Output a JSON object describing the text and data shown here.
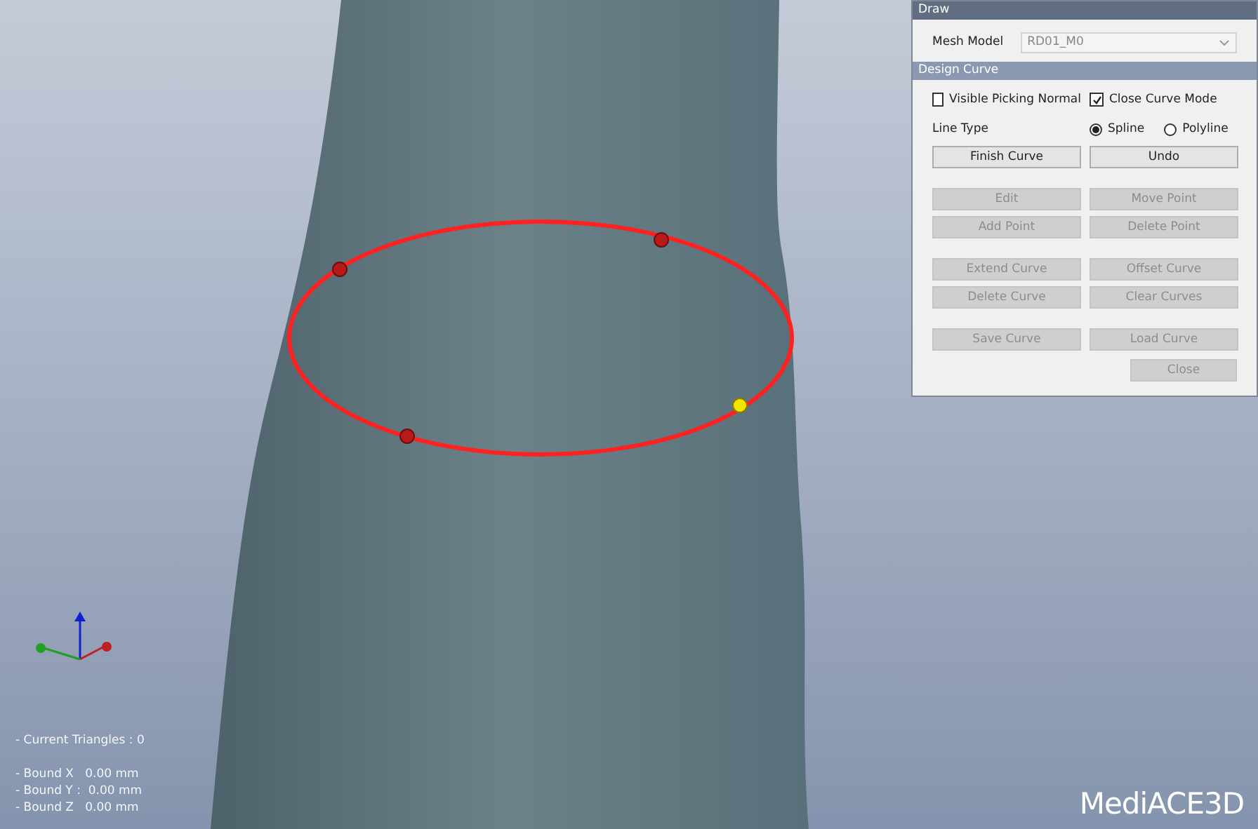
{
  "draw_panel": {
    "title": "Draw",
    "mesh_model": {
      "label": "Mesh Model",
      "value": "RD01_M0"
    }
  },
  "design_curve": {
    "title": "Design Curve",
    "checkboxes": [
      {
        "label": "Visible Picking Normal",
        "checked": false
      },
      {
        "label": "Close Curve Mode",
        "checked": true
      }
    ],
    "line_type": {
      "label": "Line Type",
      "options": [
        {
          "label": "Spline",
          "selected": true
        },
        {
          "label": "Polyline",
          "selected": false
        }
      ]
    },
    "button_groups": [
      [
        {
          "label": "Finish Curve",
          "disabled": false
        },
        {
          "label": "Undo",
          "disabled": false
        }
      ],
      [
        {
          "label": "Edit",
          "disabled": true
        },
        {
          "label": "Move Point",
          "disabled": true
        },
        {
          "label": "Add Point",
          "disabled": true
        },
        {
          "label": "Delete Point",
          "disabled": true
        }
      ],
      [
        {
          "label": "Extend Curve",
          "disabled": true
        },
        {
          "label": "Offset Curve",
          "disabled": true
        },
        {
          "label": "Delete Curve",
          "disabled": true
        },
        {
          "label": "Clear Curves",
          "disabled": true
        }
      ],
      [
        {
          "label": "Save Curve",
          "disabled": true
        },
        {
          "label": "Load Curve",
          "disabled": true
        }
      ]
    ],
    "close_button": {
      "label": "Close",
      "disabled": true
    }
  },
  "curve_points": [
    {
      "selected": false
    },
    {
      "selected": false
    },
    {
      "selected": true
    },
    {
      "selected": false
    }
  ],
  "stats": {
    "triangles": "- Current Triangles : 0",
    "bounds": [
      "- Bound X   0.00 mm",
      "- Bound Y :  0.00 mm",
      "- Bound Z   0.00 mm"
    ]
  },
  "logo": "MediACE3D"
}
